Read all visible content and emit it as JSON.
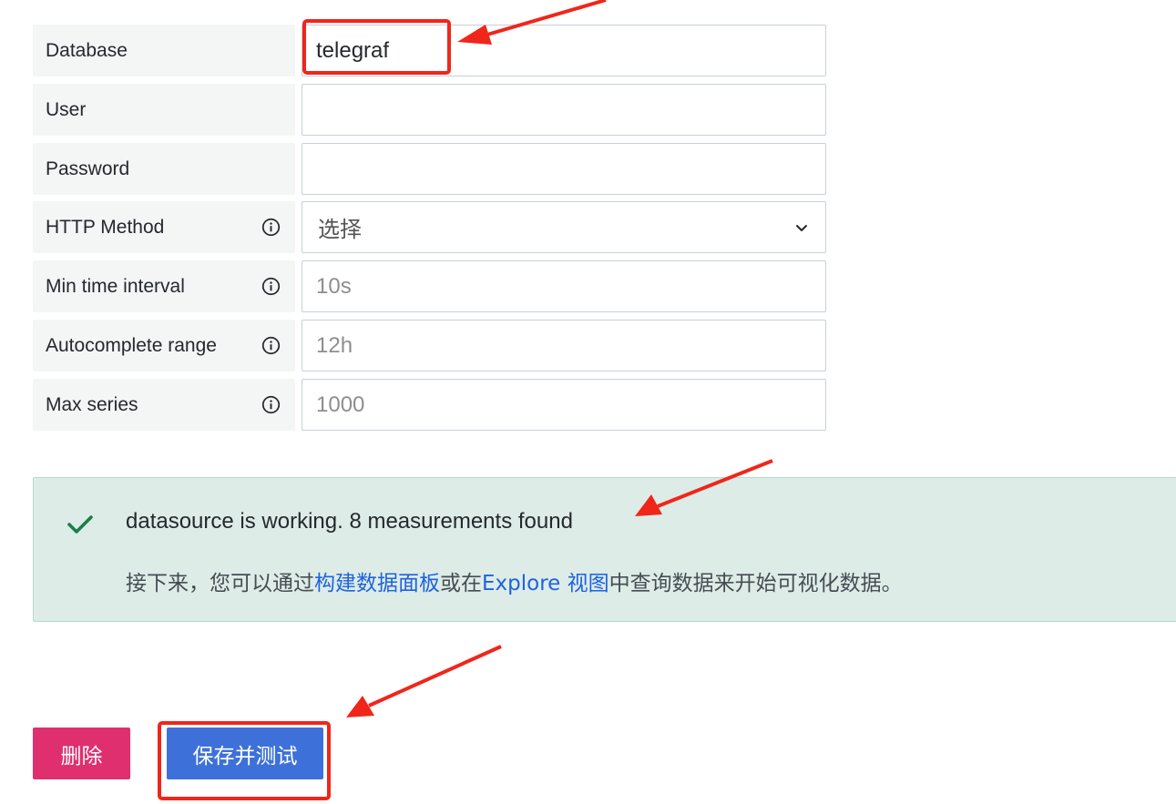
{
  "form": {
    "rows": [
      {
        "label": "Database",
        "value": "telegraf",
        "placeholder": "",
        "info": false
      },
      {
        "label": "User",
        "value": "",
        "placeholder": "",
        "info": false
      },
      {
        "label": "Password",
        "value": "",
        "placeholder": "",
        "info": false
      },
      {
        "label": "HTTP Method",
        "select_value": "选择",
        "info": true
      },
      {
        "label": "Min time interval",
        "value": "",
        "placeholder": "10s",
        "info": true
      },
      {
        "label": "Autocomplete range",
        "value": "",
        "placeholder": "12h",
        "info": true
      },
      {
        "label": "Max series",
        "value": "",
        "placeholder": "1000",
        "info": true
      }
    ]
  },
  "alert": {
    "title": "datasource is working. 8 measurements found",
    "body_prefix": "接下来，您可以通过",
    "link1": "构建数据面板",
    "body_mid": "或在",
    "link2": "Explore 视图",
    "body_suffix": "中查询数据来开始可视化数据。",
    "color": "#ddece6",
    "check_color": "#1a7f4b"
  },
  "buttons": {
    "delete_label": "删除",
    "save_label": "保存并测试",
    "delete_color": "#e02f6f",
    "save_color": "#3d71d9"
  },
  "annotations": {
    "highlight_color": "#f0261b"
  }
}
